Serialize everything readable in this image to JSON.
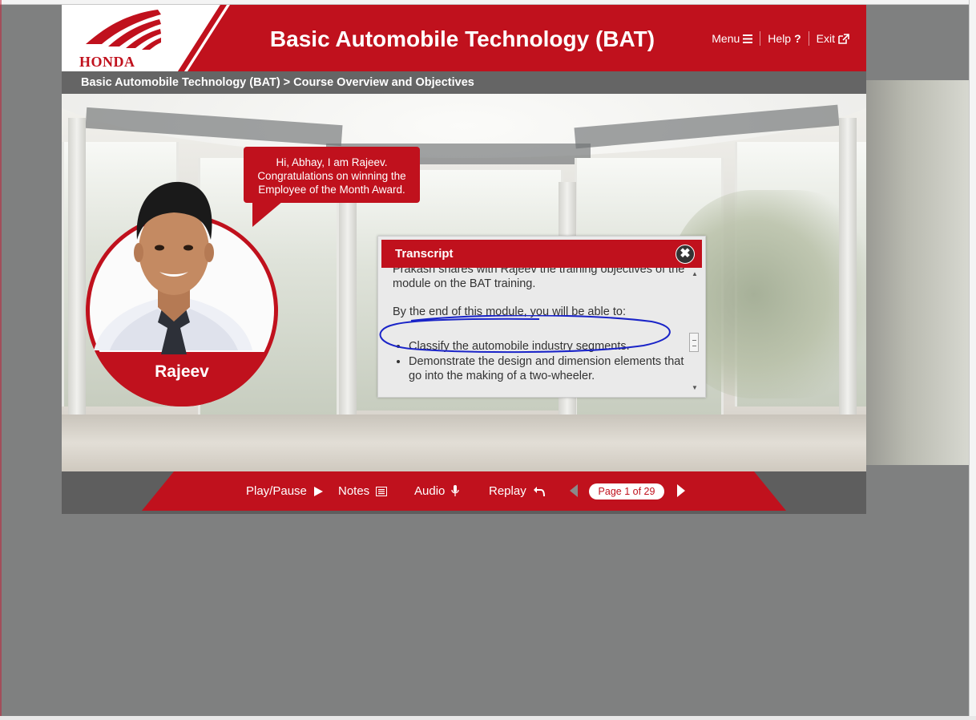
{
  "header": {
    "logo_text": "HONDA",
    "title": "Basic Automobile Technology (BAT)",
    "nav": {
      "menu_label": "Menu",
      "help_label": "Help",
      "exit_label": "Exit"
    }
  },
  "breadcrumb": "Basic Automobile Technology (BAT) > Course Overview and Objectives",
  "character": {
    "name": "Rajeev",
    "speech": "Hi, Abhay, I am Rajeev. Congratulations on winning the Employee of the Month Award."
  },
  "transcript": {
    "title": "Transcript",
    "close_symbol": "✖",
    "intro": "Prakash shares with Rajeev the training objectives of the module on the BAT training.",
    "lead": "By the end of this module, you will be able to:",
    "bullets": [
      "Classify the automobile industry segments.",
      "Demonstrate the design and dimension elements that go into the making of a two-wheeler."
    ]
  },
  "controls": {
    "play_pause_label": "Play/Pause",
    "notes_label": "Notes",
    "audio_label": "Audio",
    "replay_label": "Replay",
    "page_indicator": "Page 1 of 29"
  },
  "colors": {
    "brand_red": "#c0111d",
    "bar_gray": "#656565",
    "background_gray": "#7f8080"
  },
  "icons": {
    "menu": "hamburger-icon",
    "help": "question-icon",
    "exit": "external-link-icon",
    "play": "play-icon",
    "notes": "notes-icon",
    "audio": "microphone-icon",
    "replay": "replay-icon",
    "prev": "prev-arrow-icon",
    "next": "next-arrow-icon",
    "close": "close-icon"
  }
}
